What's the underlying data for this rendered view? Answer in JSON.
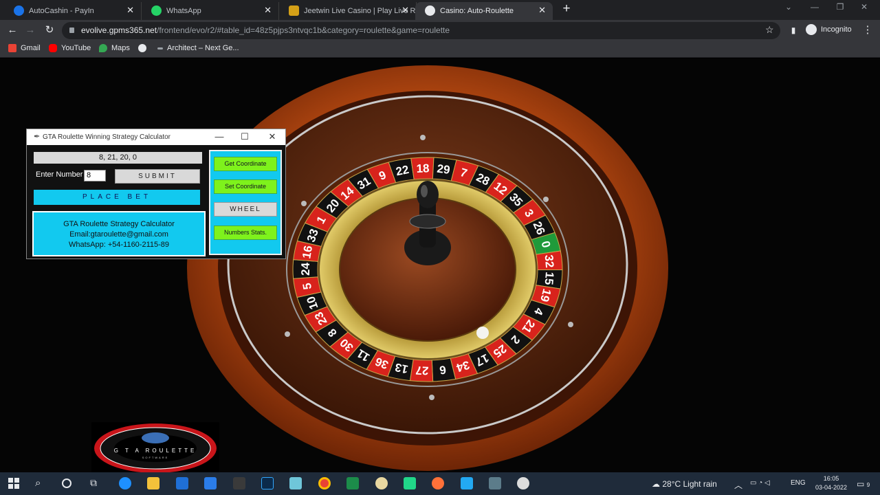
{
  "browser": {
    "tabs": [
      {
        "title": "AutoCashin - PayIn",
        "color": "#1a73e8"
      },
      {
        "title": "WhatsApp",
        "color": "#25d366"
      },
      {
        "title": "Jeetwin Live Casino | Play Live Ro",
        "color": "#d4a017"
      },
      {
        "title": "Casino: Auto-Roulette",
        "color": "#e8eaed"
      }
    ],
    "url_host": "evolive.gpms365.net",
    "url_path": "/frontend/evo/r2/#table_id=48z5pjps3ntvqc1b&category=roulette&game=roulette",
    "profile_label": "Incognito",
    "bookmarks": [
      {
        "label": "Gmail",
        "color": "#ea4335"
      },
      {
        "label": "YouTube",
        "color": "#ff0000"
      },
      {
        "label": "Maps",
        "color": "#34a853"
      },
      {
        "label": "",
        "color": "#e8eaed"
      },
      {
        "label": "Architect – Next Ge...",
        "color": "#9aa0a6"
      }
    ]
  },
  "calculator": {
    "title": "GTA Roulette Winning Strategy Calculator",
    "last_numbers": "8, 21, 20, 0",
    "enter_label": "Enter Number",
    "number_value": "8",
    "submit_label": "SUBMIT",
    "place_bet_label": "PLACE BET",
    "info": {
      "line1": "GTA Roulette Strategy Calculator",
      "line2": "Email:gtaroulette@gmail.com",
      "line3": "WhatsApp: +54-1160-2115-89"
    },
    "buttons": {
      "get_coordinate": "Get Coordinate",
      "set_coordinate": "Set Coordinate",
      "wheel": "WHEEL",
      "numbers_stats": "Numbers Stats."
    }
  },
  "wheel": {
    "numbers": [
      0,
      32,
      15,
      19,
      4,
      21,
      2,
      25,
      17,
      34,
      6,
      27,
      13,
      36,
      11,
      30,
      8,
      23,
      10,
      5,
      24,
      16,
      33,
      1,
      20,
      14,
      31,
      9,
      22,
      18,
      29,
      7,
      28,
      12,
      35,
      3,
      26
    ]
  },
  "logo": {
    "text": "G T A ROULETTE",
    "subtext": "SOFTWARE"
  },
  "taskbar": {
    "weather": "28°C  Light rain",
    "language": "ENG",
    "time": "16:05",
    "date": "03-04-2022",
    "notifications": "9"
  }
}
